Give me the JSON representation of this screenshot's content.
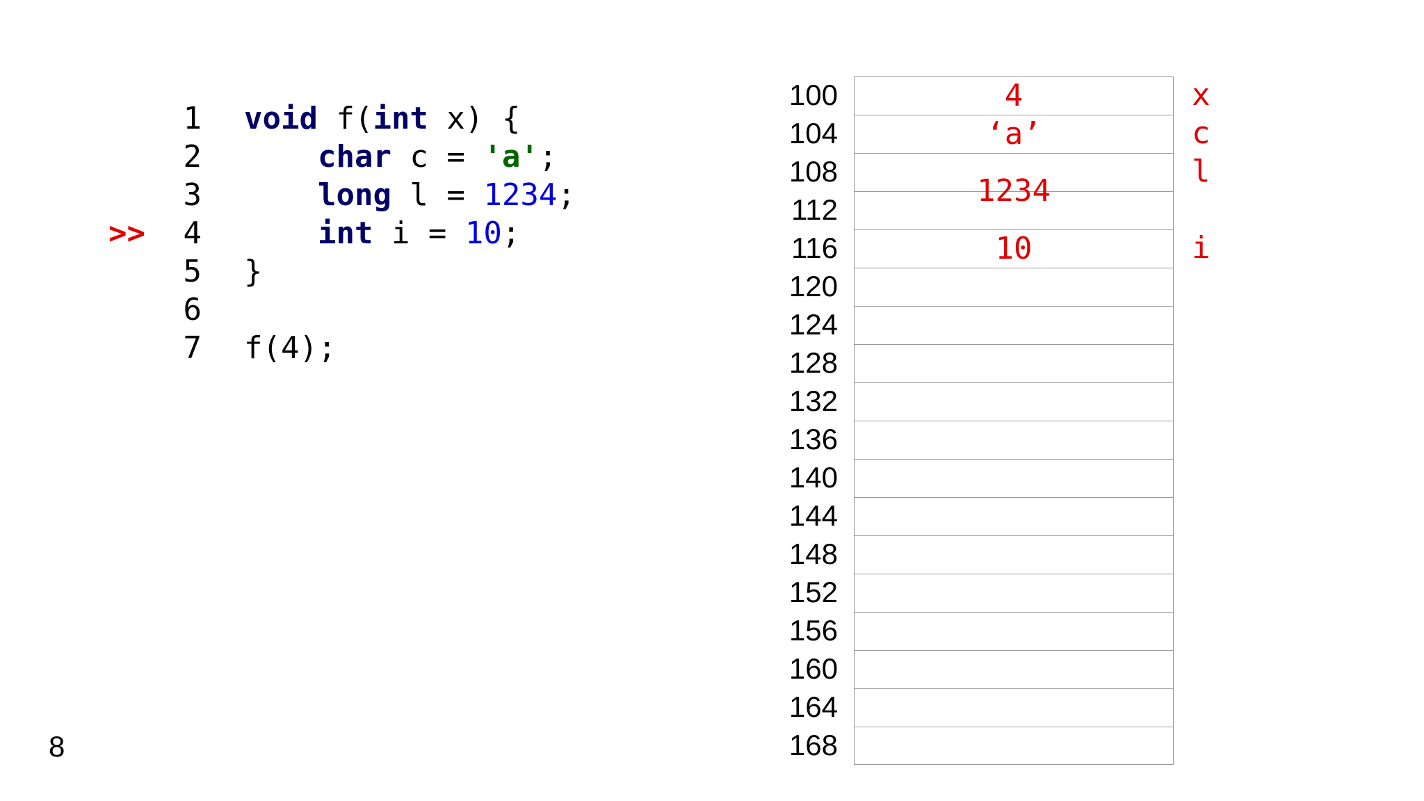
{
  "code": {
    "current_marker": ">>",
    "lines": [
      {
        "number": "1",
        "tokens": [
          {
            "t": "void",
            "k": "kw"
          },
          {
            "t": " f(",
            "k": "pl"
          },
          {
            "t": "int",
            "k": "kw"
          },
          {
            "t": " x) {",
            "k": "pl"
          }
        ]
      },
      {
        "number": "2",
        "tokens": [
          {
            "t": "    ",
            "k": "pl"
          },
          {
            "t": "char",
            "k": "kw"
          },
          {
            "t": " c = ",
            "k": "pl"
          },
          {
            "t": "'a'",
            "k": "str"
          },
          {
            "t": ";",
            "k": "pl"
          }
        ]
      },
      {
        "number": "3",
        "tokens": [
          {
            "t": "    ",
            "k": "pl"
          },
          {
            "t": "long",
            "k": "kw"
          },
          {
            "t": " l = ",
            "k": "pl"
          },
          {
            "t": "1234",
            "k": "num"
          },
          {
            "t": ";",
            "k": "pl"
          }
        ]
      },
      {
        "number": "4",
        "current": true,
        "tokens": [
          {
            "t": "    ",
            "k": "pl"
          },
          {
            "t": "int",
            "k": "kw"
          },
          {
            "t": " i = ",
            "k": "pl"
          },
          {
            "t": "10",
            "k": "num"
          },
          {
            "t": ";",
            "k": "pl"
          }
        ]
      },
      {
        "number": "5",
        "tokens": [
          {
            "t": "}",
            "k": "pl"
          }
        ]
      },
      {
        "number": "6",
        "tokens": []
      },
      {
        "number": "7",
        "tokens": [
          {
            "t": "f(4);",
            "k": "pl"
          }
        ]
      }
    ]
  },
  "memory": {
    "addresses": [
      "100",
      "104",
      "108",
      "112",
      "116",
      "120",
      "124",
      "128",
      "132",
      "136",
      "140",
      "144",
      "148",
      "152",
      "156",
      "160",
      "164",
      "168"
    ],
    "values": [
      {
        "value": "4",
        "start_address": "100",
        "span_rows": 1,
        "name": "x"
      },
      {
        "value": "‘a’",
        "start_address": "104",
        "span_rows": 1,
        "name": "c"
      },
      {
        "value": "1234",
        "start_address": "108",
        "span_rows": 2,
        "name": "l"
      },
      {
        "value": "10",
        "start_address": "116",
        "span_rows": 1,
        "name": "i"
      }
    ]
  },
  "page_number": "8",
  "colors": {
    "keyword": "#000066",
    "char_literal": "#006600",
    "number_literal": "#0000dd",
    "memory_value": "#e00000",
    "marker": "#e00000"
  }
}
